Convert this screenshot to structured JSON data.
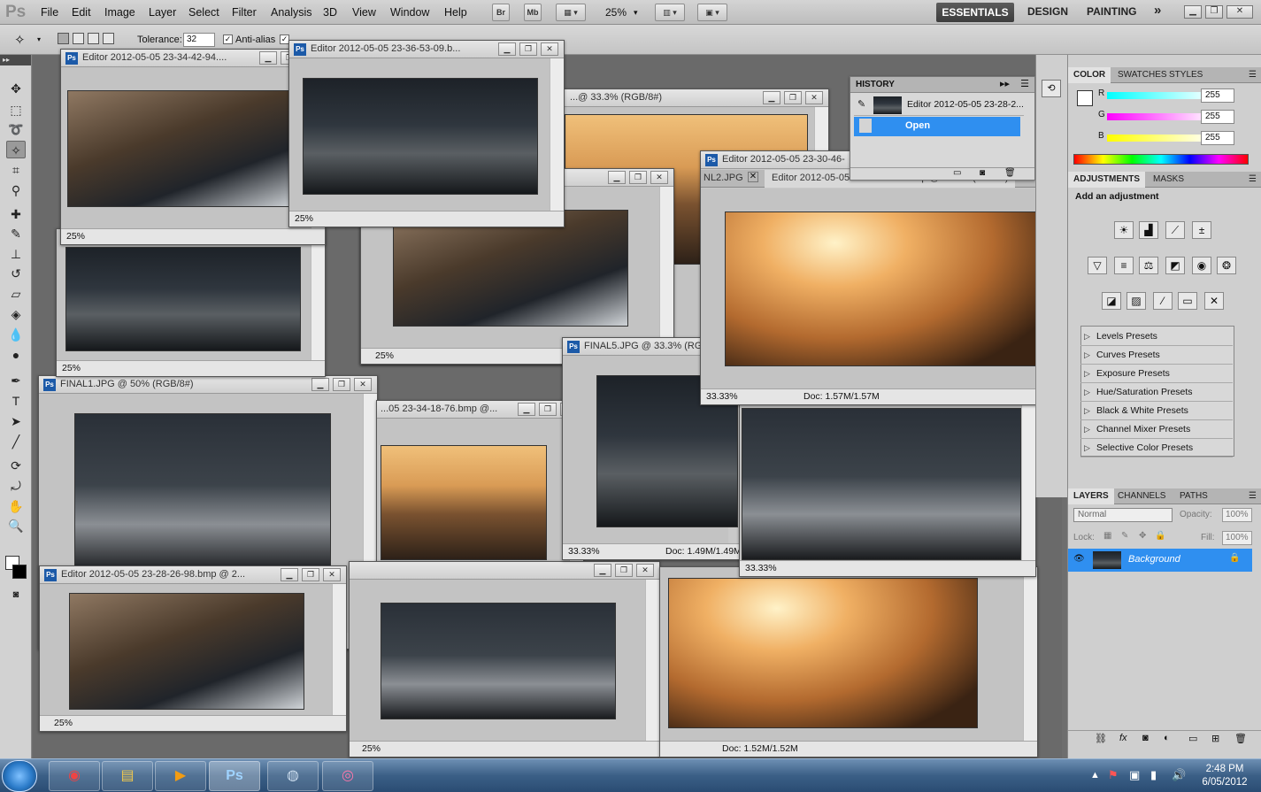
{
  "app": {
    "logo": "Ps"
  },
  "menu": [
    "File",
    "Edit",
    "Image",
    "Layer",
    "Select",
    "Filter",
    "Analysis",
    "3D",
    "View",
    "Window",
    "Help"
  ],
  "menubar_buttons": {
    "br": "Br",
    "mb": "Mb",
    "zoom": "25%"
  },
  "workspaces": {
    "essentials": "ESSENTIALS",
    "design": "DESIGN",
    "painting": "PAINTING",
    "more": "»"
  },
  "options": {
    "tolerance_label": "Tolerance:",
    "tolerance_value": "32",
    "antialias_label": "Anti-alias",
    "antialias_checked": true,
    "contiguous_checked": true
  },
  "documents": [
    {
      "title": "Editor 2012-05-05 23-34-42-94....",
      "zoom": "25%"
    },
    {
      "title": "Editor 2012-05-05 23-36-53-09.b...",
      "zoom": "25%"
    },
    {
      "title": "...@ 33.3% (RGB/8#)",
      "zoom": ""
    },
    {
      "title": "Editor 2012-05-05 23-30-46-",
      "zoom": ""
    },
    {
      "title": "FINAL1.JPG @ 50% (RGB/8#)",
      "zoom": "25%"
    },
    {
      "title": "FINAL5.JPG @ 33.3% (RGB/8#)",
      "zoom": "33.33%",
      "docsize": "Doc: 1.49M/1.49M"
    },
    {
      "title": "...05 23-34-18-76.bmp @...",
      "zoom": ""
    },
    {
      "title": "Editor 2012-05-05 23-28-26-98.bmp @ 2...",
      "zoom": "25%"
    },
    {
      "title": "",
      "zoom": "25%"
    },
    {
      "title": "",
      "zoom": "33.33%"
    },
    {
      "title": "",
      "zoom": "",
      "docsize": "Doc: 1.52M/1.52M"
    }
  ],
  "tabbed_doc": {
    "tab1": "NL2.JPG",
    "tab2": "Editor 2012-05-05 23-30-46-09.bmp @ 33.3% (RGB/8)",
    "zoom": "33.33%",
    "docsize": "Doc: 1.57M/1.57M"
  },
  "history": {
    "tab": "HISTORY",
    "snapshot": "Editor 2012-05-05 23-28-2...",
    "step": "Open"
  },
  "color_panel": {
    "tabs": [
      "COLOR",
      "SWATCHES",
      "STYLES"
    ],
    "r_label": "R",
    "g_label": "G",
    "b_label": "B",
    "r": "255",
    "g": "255",
    "b": "255",
    "r_color": "#22d0d0",
    "g_color": "#d022d0",
    "b_color": "#d0d022"
  },
  "adjustments": {
    "tabs": [
      "ADJUSTMENTS",
      "MASKS"
    ],
    "hint": "Add an adjustment",
    "presets": [
      "Levels Presets",
      "Curves Presets",
      "Exposure Presets",
      "Hue/Saturation Presets",
      "Black & White Presets",
      "Channel Mixer Presets",
      "Selective Color Presets"
    ]
  },
  "layers": {
    "tabs": [
      "LAYERS",
      "CHANNELS",
      "PATHS"
    ],
    "blend_mode": "Normal",
    "opacity_label": "Opacity:",
    "opacity": "100%",
    "lock_label": "Lock:",
    "fill_label": "Fill:",
    "fill": "100%",
    "layer_name": "Background"
  },
  "taskbar": {
    "time": "2:48 PM",
    "date": "6/05/2012"
  }
}
